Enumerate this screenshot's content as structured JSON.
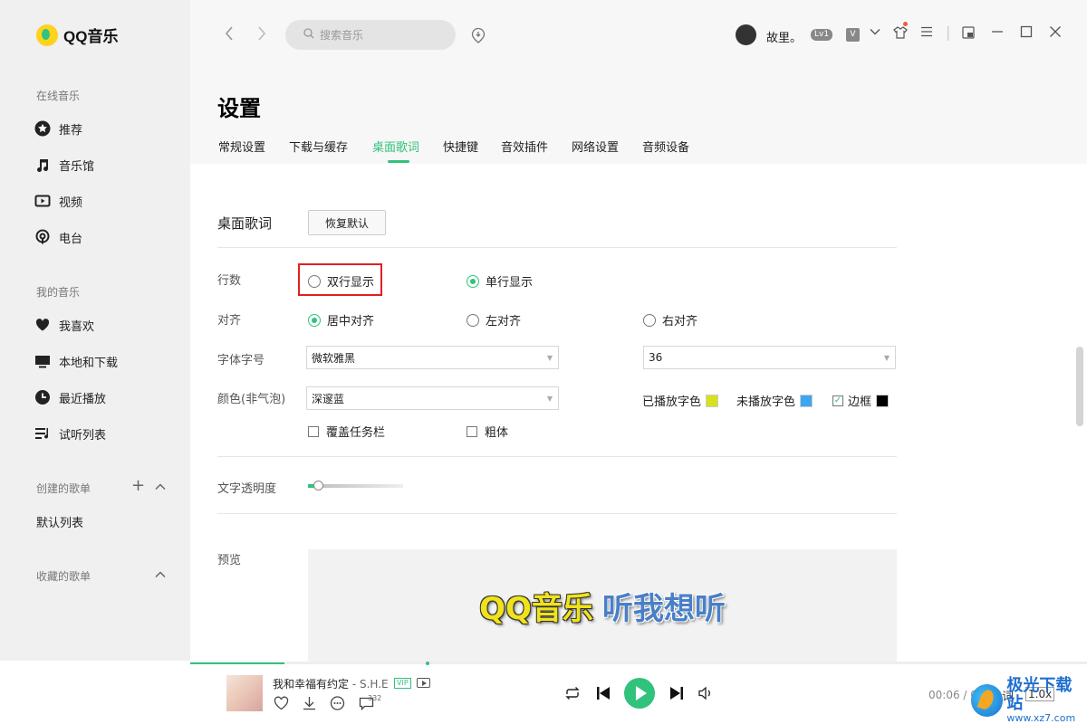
{
  "app": {
    "logo_text": "QQ音乐"
  },
  "sidebar": {
    "online_title": "在线音乐",
    "online_items": [
      {
        "label": "推荐",
        "icon": "star-icon"
      },
      {
        "label": "音乐馆",
        "icon": "music-note-icon"
      },
      {
        "label": "视频",
        "icon": "video-icon"
      },
      {
        "label": "电台",
        "icon": "radio-icon"
      }
    ],
    "mymusic_title": "我的音乐",
    "mymusic_items": [
      {
        "label": "我喜欢",
        "icon": "heart-icon"
      },
      {
        "label": "本地和下载",
        "icon": "monitor-icon"
      },
      {
        "label": "最近播放",
        "icon": "clock-icon"
      },
      {
        "label": "试听列表",
        "icon": "playlist-icon"
      }
    ],
    "created_title": "创建的歌单",
    "created_items": [
      "默认列表"
    ],
    "collected_title": "收藏的歌单"
  },
  "header": {
    "search_placeholder": "搜索音乐",
    "username": "故里。",
    "level_badge": "Lv1",
    "vip_badge": "V"
  },
  "settings": {
    "title": "设置",
    "tabs": [
      "常规设置",
      "下载与缓存",
      "桌面歌词",
      "快捷键",
      "音效插件",
      "网络设置",
      "音频设备"
    ],
    "active_tab": "桌面歌词",
    "section_title": "桌面歌词",
    "reset_button": "恢复默认",
    "rows_label": "行数",
    "rows_options": [
      {
        "label": "双行显示",
        "checked": false
      },
      {
        "label": "单行显示",
        "checked": true
      }
    ],
    "align_label": "对齐",
    "align_options": [
      {
        "label": "居中对齐",
        "checked": true
      },
      {
        "label": "左对齐",
        "checked": false
      },
      {
        "label": "右对齐",
        "checked": false
      }
    ],
    "font_label": "字体字号",
    "font_value": "微软雅黑",
    "size_value": "36",
    "color_label": "颜色(非气泡)",
    "color_value": "深邃蓝",
    "played_color_label": "已播放字色",
    "played_color": "#d6e21b",
    "unplayed_color_label": "未播放字色",
    "unplayed_color": "#3ea6f0",
    "border_label": "边框",
    "border_checked": true,
    "border_color": "#000000",
    "cover_taskbar_label": "覆盖任务栏",
    "cover_taskbar_checked": false,
    "bold_label": "粗体",
    "bold_checked": false,
    "opacity_label": "文字透明度",
    "opacity_level": 0.1,
    "preview_label": "预览",
    "preview_text_1": "QQ音乐",
    "preview_text_2": "听我想听"
  },
  "player": {
    "song_title": "我和幸福有约定",
    "artist": "- S.H.E",
    "vip_tag": "VIP",
    "comment_count": "332",
    "time": "00:06 / 01:00",
    "lyric_btn": "词",
    "speed": "1.0x"
  },
  "watermark": {
    "title": "极光下载站",
    "url": "www.xz7.com"
  },
  "colors": {
    "accent": "#31c27c",
    "highlight_box": "#e02020"
  }
}
